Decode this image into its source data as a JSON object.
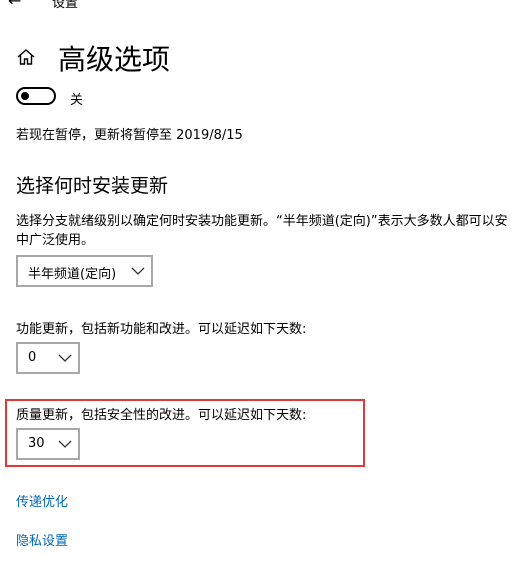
{
  "header": {
    "title": "设置",
    "back_icon": "back-arrow-icon"
  },
  "page": {
    "title": "高级选项",
    "home_icon": "home-icon"
  },
  "pause_toggle": {
    "state_label": "关",
    "status_text": "若现在暂停，更新将暂停至 2019/8/15"
  },
  "section": {
    "title": "选择何时安装更新",
    "description_lines": [
      "选择分支就绪级别以确定何时安装功能更新。“半年频道(定向)”表示大多数人都可以安",
      "中广泛使用。"
    ]
  },
  "branch_select": {
    "value": "半年频道(定向)"
  },
  "feature_updates": {
    "label": "功能更新，包括新功能和改进。可以延迟如下天数:",
    "value": "0"
  },
  "quality_updates": {
    "label": "质量更新，包括安全性的改进。可以延迟如下天数:",
    "value": "30"
  },
  "links": {
    "delivery": "传递优化",
    "privacy": "隐私设置"
  },
  "colors": {
    "link": "#0067b8",
    "highlight": "#e03a3a",
    "select_border": "#a8a8a8"
  }
}
